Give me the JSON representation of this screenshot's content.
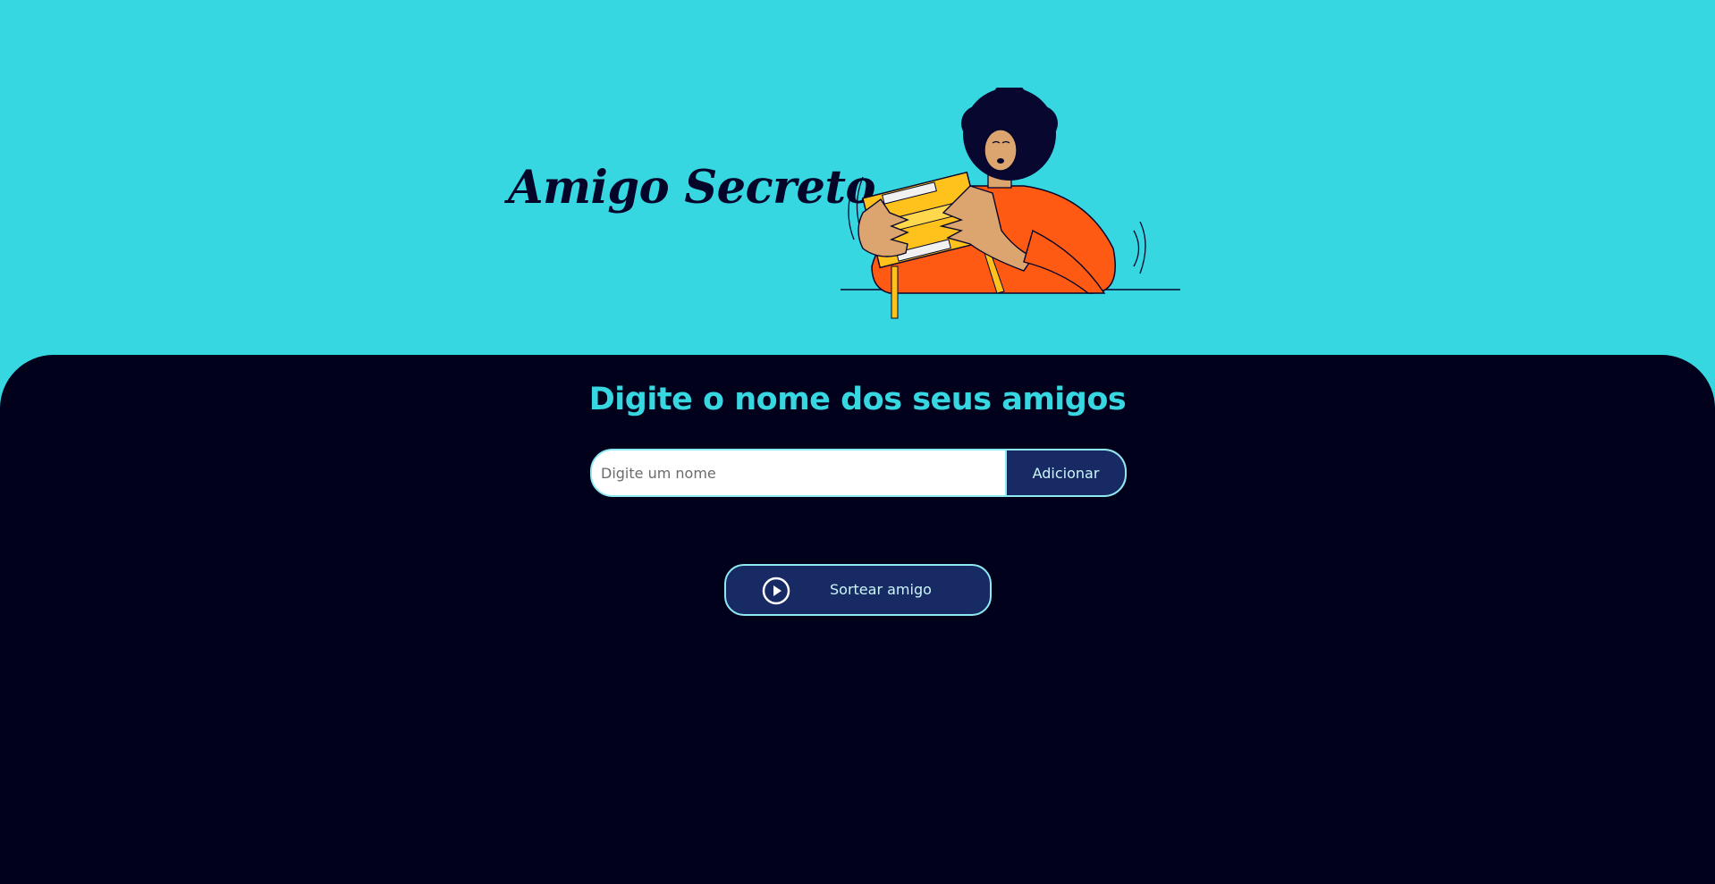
{
  "header": {
    "title": "Amigo Secreto"
  },
  "main": {
    "subtitle": "Digite o nome dos seus amigos",
    "name_input": {
      "value": "",
      "placeholder": "Digite um nome"
    },
    "add_button_label": "Adicionar",
    "draw_button_label": "Sortear amigo",
    "draw_button_icon": "play-circle-icon"
  },
  "colors": {
    "header_background": "#37d7e2",
    "main_background": "#01011c",
    "accent": "#37d7e2",
    "button_background": "#172a63",
    "button_border": "#8fe9f0",
    "title_text": "#05052a"
  }
}
